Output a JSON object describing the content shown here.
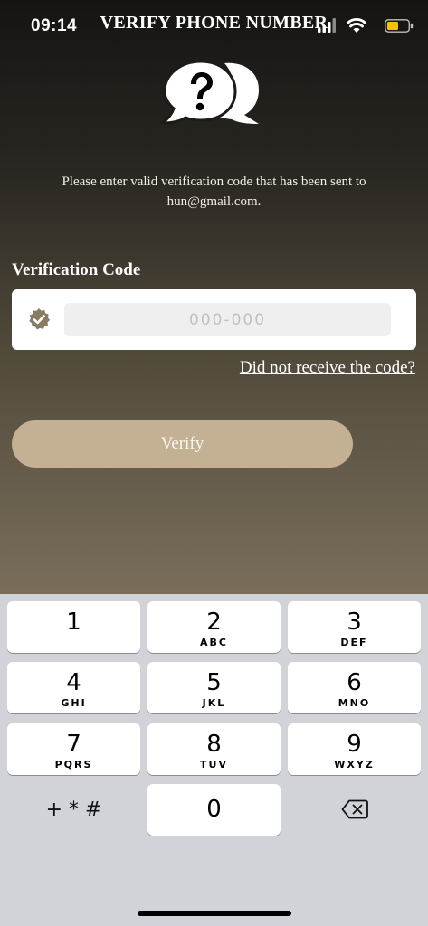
{
  "status_bar": {
    "time": "09:14",
    "title": "VERIFY PHONE NUMBER",
    "icons": [
      "signal-icon",
      "wifi-icon",
      "battery-icon"
    ],
    "battery_color": "#f5c400"
  },
  "header_icon": "question-chat-bubbles-icon",
  "message": "Please enter valid verification code that has been sent to hun@gmail.com.",
  "form": {
    "label": "Verification Code",
    "code_placeholder": "000-000",
    "code_value": "",
    "field_icon": "verified-badge-icon",
    "resend_link": "Did not receive the code?",
    "verify_button": "Verify"
  },
  "colors": {
    "accent": "#c4b092",
    "badge": "#8a7a62",
    "keyboard_bg": "#d1d3d9"
  },
  "keypad": {
    "keys": [
      {
        "digit": "1",
        "letters": ""
      },
      {
        "digit": "2",
        "letters": "ABC"
      },
      {
        "digit": "3",
        "letters": "DEF"
      },
      {
        "digit": "4",
        "letters": "GHI"
      },
      {
        "digit": "5",
        "letters": "JKL"
      },
      {
        "digit": "6",
        "letters": "MNO"
      },
      {
        "digit": "7",
        "letters": "PQRS"
      },
      {
        "digit": "8",
        "letters": "TUV"
      },
      {
        "digit": "9",
        "letters": "WXYZ"
      }
    ],
    "symbols": "+ * #",
    "zero": "0",
    "delete_icon": "backspace-icon"
  }
}
